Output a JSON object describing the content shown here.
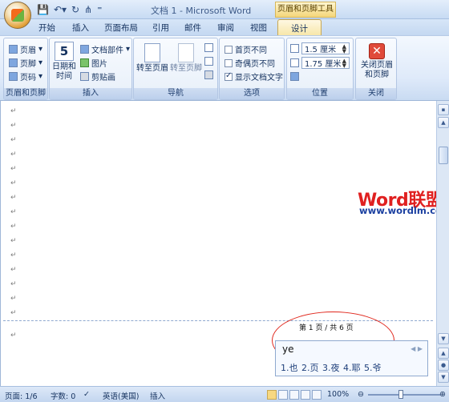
{
  "window": {
    "title": "文档 1 - Microsoft Word",
    "context_title": "页眉和页脚工具"
  },
  "tabs": [
    "开始",
    "插入",
    "页面布局",
    "引用",
    "邮件",
    "审阅",
    "视图",
    "设计"
  ],
  "ribbon": {
    "hf_group": {
      "label": "页眉和页脚",
      "header": "页眉",
      "footer": "页脚",
      "page_number": "页码"
    },
    "insert_group": {
      "label": "插入",
      "date_time_1": "日期和",
      "date_time_2": "时间",
      "calendar_day": "5",
      "doc_parts": "文档部件",
      "picture": "图片",
      "clipart": "剪贴画"
    },
    "nav_group": {
      "label": "导航",
      "goto_header": "转至页眉",
      "goto_footer": "转至页脚"
    },
    "options_group": {
      "label": "选项",
      "diff_first": "首页不同",
      "diff_odd_even": "奇偶页不同",
      "show_text": "显示文档文字"
    },
    "position_group": {
      "label": "位置",
      "header_pos": "1.5 厘米",
      "footer_pos": "1.75 厘米"
    },
    "close_group": {
      "label": "关闭",
      "close_1": "关闭页眉",
      "close_2": "和页脚"
    }
  },
  "document": {
    "pilcrow": "↵",
    "watermark_title": "Word联盟",
    "watermark_url": "www.wordlm.com",
    "footer_page_text": "第 1 页 / 共 6 页"
  },
  "ime": {
    "composition": "ye",
    "candidates": "1.也 2.页 3.夜 4.耶 5.爷"
  },
  "status": {
    "page": "页面: 1/6",
    "words": "字数: 0",
    "language": "英语(美国)",
    "mode": "插入",
    "zoom": "100%"
  }
}
